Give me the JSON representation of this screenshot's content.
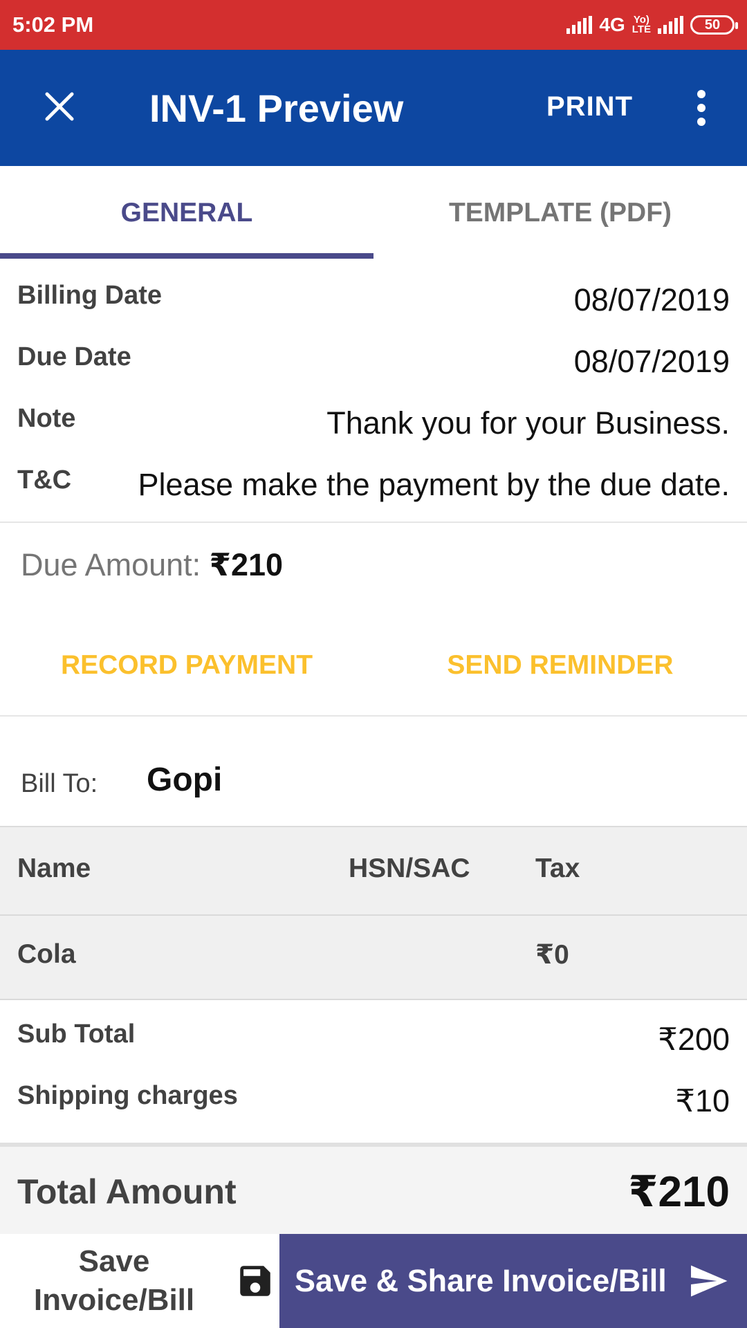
{
  "status_bar": {
    "time": "5:02 PM",
    "network": "4G",
    "volte_top": "Yo)",
    "volte_bottom": "LTE",
    "battery": "50"
  },
  "app_bar": {
    "title": "INV-1 Preview",
    "print_label": "PRINT"
  },
  "tabs": [
    {
      "label": "GENERAL",
      "selected": true
    },
    {
      "label": "TEMPLATE (PDF)",
      "selected": false
    }
  ],
  "details": {
    "billing_date_label": "Billing Date",
    "billing_date": "08/07/2019",
    "due_date_label": "Due Date",
    "due_date": "08/07/2019",
    "note_label": "Note",
    "note": "Thank you for your Business.",
    "tc_label": "T&C",
    "tc": "Please make the payment by the due date."
  },
  "due": {
    "label": "Due Amount:",
    "value": "₹210"
  },
  "actions": {
    "record_payment": "RECORD PAYMENT",
    "send_reminder": "SEND REMINDER"
  },
  "bill_to": {
    "label": "Bill To:",
    "name": "Gopi"
  },
  "items_table": {
    "headers": {
      "name": "Name",
      "hsn": "HSN/SAC",
      "tax": "Tax"
    },
    "rows": [
      {
        "name": "Cola",
        "hsn": "",
        "tax": "₹0"
      }
    ]
  },
  "summary": {
    "subtotal_label": "Sub Total",
    "subtotal": "₹200",
    "shipping_label": "Shipping charges",
    "shipping": "₹10",
    "total_label": "Total Amount",
    "total": "₹210"
  },
  "bottom": {
    "save_line1": "Save",
    "save_line2": "Invoice/Bill",
    "share_label": "Save & Share Invoice/Bill"
  },
  "colors": {
    "status_bar": "#d32f2f",
    "app_bar": "#0d47a1",
    "tab_accent": "#4a4a8a",
    "action_text": "#fbc02d"
  },
  "icons": [
    "close-icon",
    "more-vert-icon",
    "floppy-disk-icon",
    "send-icon"
  ]
}
